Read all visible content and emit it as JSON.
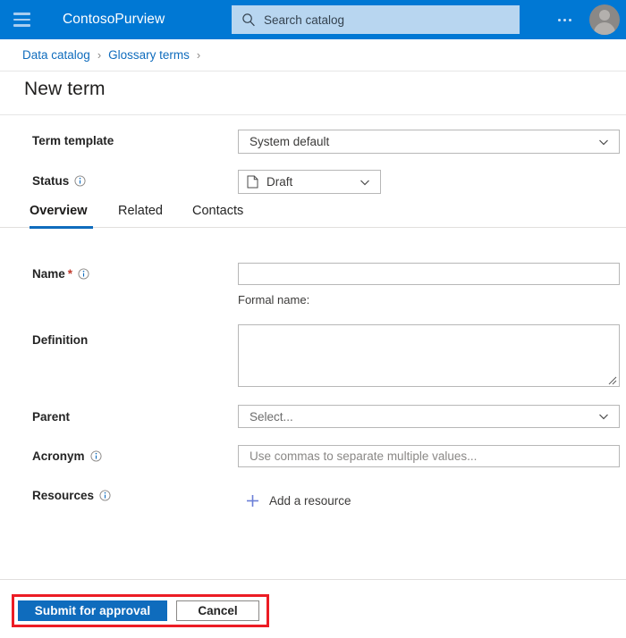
{
  "topbar": {
    "menu_icon": "hamburger-icon",
    "brand": "ContosoPurview",
    "search": {
      "icon": "search-icon",
      "placeholder": "Search catalog",
      "value": ""
    },
    "more_icon": "ellipsis-icon",
    "avatar_icon": "user-avatar-icon",
    "background_color": "#0078d4",
    "search_background_color": "#b8d6f0"
  },
  "breadcrumb": {
    "items": [
      {
        "label": "Data catalog"
      },
      {
        "label": "Glossary terms"
      }
    ],
    "separator": "›",
    "link_color": "#0f6cbd"
  },
  "page": {
    "title": "New term"
  },
  "form": {
    "term_template": {
      "label": "Term template",
      "value": "System default",
      "chevron_icon": "chevron-down-icon"
    },
    "status": {
      "label": "Status",
      "info_icon": "info-icon",
      "value": "Draft",
      "value_icon": "document-icon",
      "chevron_icon": "chevron-down-icon"
    },
    "name": {
      "label": "Name",
      "required_marker": "*",
      "info_icon": "info-icon",
      "value": "",
      "placeholder": "",
      "helper": "Formal name:"
    },
    "definition": {
      "label": "Definition",
      "value": "",
      "resize_icon": "resize-grip-icon"
    },
    "parent": {
      "label": "Parent",
      "value": "Select...",
      "chevron_icon": "chevron-down-icon"
    },
    "acronym": {
      "label": "Acronym",
      "info_icon": "info-icon",
      "value": "",
      "placeholder": "Use commas to separate multiple values..."
    },
    "resources": {
      "label": "Resources",
      "info_icon": "info-icon",
      "add_label": "Add a resource",
      "add_icon": "plus-icon"
    }
  },
  "tabs": {
    "items": [
      {
        "label": "Overview",
        "active": true
      },
      {
        "label": "Related",
        "active": false
      },
      {
        "label": "Contacts",
        "active": false
      }
    ],
    "active_underline_color": "#0f6cbd"
  },
  "footer": {
    "submit_label": "Submit for approval",
    "cancel_label": "Cancel",
    "primary_color": "#0f6cbd",
    "highlight_color": "#ec1c24"
  }
}
